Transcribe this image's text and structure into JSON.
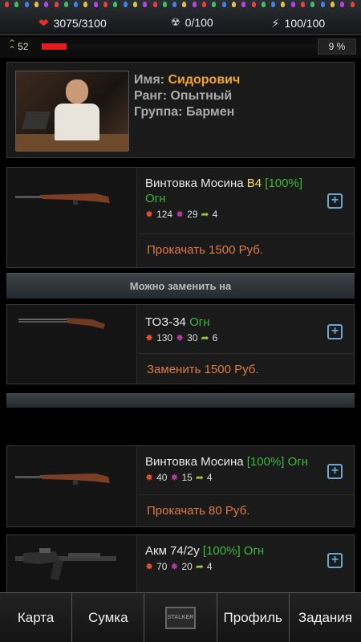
{
  "status": {
    "health": "3075/3100",
    "radiation": "0/100",
    "energy": "100/100"
  },
  "xp": {
    "level": "52",
    "progress": 0.09,
    "percent_label": "9 %"
  },
  "profile": {
    "name_label": "Имя:",
    "name": "Сидорович",
    "rank_label": "Ранг:",
    "rank": "Опытный",
    "group_label": "Группа:",
    "group": "Бармен"
  },
  "current_item": {
    "name": "Винтовка Мосина",
    "mod_level": "B4",
    "mod_percent": "[100%]",
    "mod_type": "Огн",
    "damage": "124",
    "penetration": "29",
    "rate": "4",
    "action": "Прокачать 1500 Руб."
  },
  "replace_header": "Можно заменить на",
  "replacement_item": {
    "name": "ТОЗ-34",
    "mod_type": "Огн",
    "damage": "130",
    "penetration": "30",
    "rate": "6",
    "action": "Заменить 1500 Руб."
  },
  "inventory": [
    {
      "name": "Винтовка Мосина",
      "mod_percent": "[100%]",
      "mod_type": "Огн",
      "damage": "40",
      "penetration": "15",
      "rate": "4",
      "action": "Прокачать 80 Руб."
    },
    {
      "name": "Акм 74/2у",
      "mod_percent": "[100%]",
      "mod_type": "Огн",
      "damage": "70",
      "penetration": "20",
      "rate": "4"
    }
  ],
  "nav": {
    "map": "Карта",
    "bag": "Сумка",
    "logo": "STALKER",
    "profile": "Профиль",
    "tasks": "Задания"
  },
  "icons": {
    "health": "heart-icon",
    "radiation": "radiation-icon",
    "energy": "energy-icon",
    "rank": "rank-chevron-icon",
    "damage": "damage-icon",
    "penetration": "penetration-icon",
    "rate": "rate-icon",
    "add": "plus-icon"
  },
  "colors": {
    "name": "#f5a623",
    "mod_yellow": "#f2e33b",
    "mod_green": "#3cb83c",
    "action": "#e07a40",
    "xp_fill": "#e21b1b",
    "plus": "#6aa7cf"
  }
}
